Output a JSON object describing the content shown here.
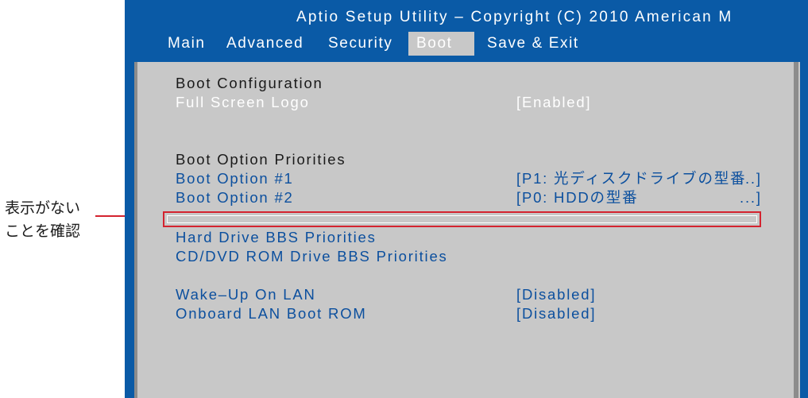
{
  "annotation": {
    "line1": "表示がない",
    "line2": "ことを確認"
  },
  "header": {
    "title": "Aptio Setup Utility – Copyright (C) 2010 American M",
    "tabs": [
      {
        "label": "Main",
        "active": false
      },
      {
        "label": "Advanced",
        "active": false
      },
      {
        "label": "Security",
        "active": false
      },
      {
        "label": "Boot",
        "active": true
      },
      {
        "label": "Save & Exit",
        "active": false
      }
    ]
  },
  "boot": {
    "config_heading": "Boot Configuration",
    "full_screen_logo": {
      "label": "Full Screen Logo",
      "value": "[Enabled]"
    },
    "priorities_heading": "Boot Option Priorities",
    "option1": {
      "label": "Boot Option #1",
      "value": "[P1:  光ディスクドライブの型番",
      "tail": "...]"
    },
    "option2": {
      "label": "Boot Option #2",
      "value": "[P0:  HDDの型番",
      "tail": "...]"
    },
    "hdd_bbs": "Hard Drive BBS Priorities",
    "cddvd_bbs": "CD/DVD ROM Drive BBS Priorities",
    "wake_on_lan": {
      "label": "Wake–Up On LAN",
      "value": "[Disabled]"
    },
    "onboard_lan_rom": {
      "label": "Onboard LAN Boot ROM",
      "value": "[Disabled]"
    }
  },
  "colors": {
    "bios_blue": "#0a5aa6",
    "panel_gray": "#c8c8c8",
    "highlight_red": "#d4232f",
    "item_blue": "#0b4f9e"
  }
}
